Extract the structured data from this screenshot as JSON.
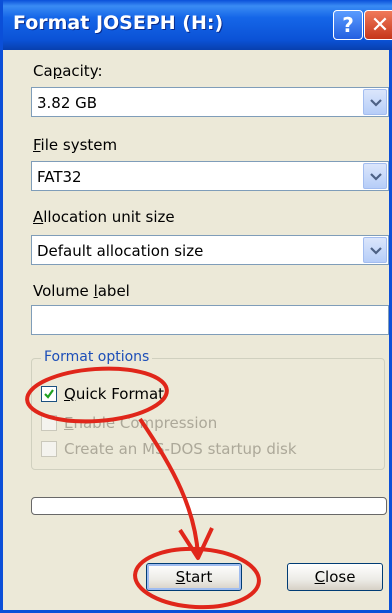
{
  "window": {
    "title": "Format JOSEPH (H:)",
    "help_glyph": "?",
    "close_glyph": "✕"
  },
  "capacity": {
    "label_pre": "Ca",
    "label_key": "p",
    "label_post": "acity:",
    "value": "3.82 GB"
  },
  "file_system": {
    "label_pre": "",
    "label_key": "F",
    "label_post": "ile system",
    "value": "FAT32"
  },
  "allocation": {
    "label_pre": "",
    "label_key": "A",
    "label_post": "llocation unit size",
    "value": "Default allocation size"
  },
  "volume": {
    "label_pre": "Volume ",
    "label_key": "l",
    "label_post": "abel",
    "value": ""
  },
  "format_options": {
    "legend": "Format options",
    "quick_format": {
      "label_key": "Q",
      "label_post": "uick Format",
      "checked": true
    },
    "compression": {
      "label_key": "E",
      "label_post": "nable Compression",
      "checked": false,
      "enabled": false
    },
    "msdos": {
      "label": "Create an MS-DOS startup disk",
      "checked": false,
      "enabled": false
    }
  },
  "progress": {
    "value": 0
  },
  "buttons": {
    "start_key": "S",
    "start_post": "tart",
    "close_key": "C",
    "close_post": "lose"
  },
  "colors": {
    "titlebar": "#0b52d6",
    "annotation": "#e0261a",
    "legend": "#1c4eb8"
  },
  "icons": [
    "help-icon",
    "close-icon",
    "dropdown-arrow-icon",
    "checkmark-icon"
  ]
}
